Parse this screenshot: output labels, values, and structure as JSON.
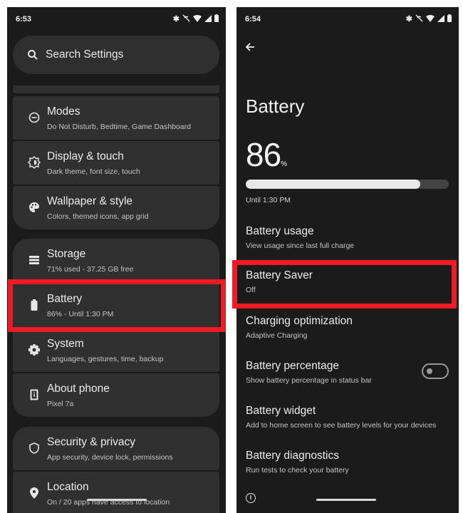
{
  "left": {
    "status": {
      "time": "6:53"
    },
    "search_placeholder": "Search Settings",
    "items": [
      {
        "title": "Modes",
        "subtitle": "Do Not Disturb, Bedtime, Game Dashboard",
        "icon": "minus-circle-icon"
      },
      {
        "title": "Display & touch",
        "subtitle": "Dark theme, font size, touch",
        "icon": "brightness-icon"
      },
      {
        "title": "Wallpaper & style",
        "subtitle": "Colors, themed icons, app grid",
        "icon": "palette-icon"
      },
      {
        "title": "Storage",
        "subtitle": "71% used - 37.25 GB free",
        "icon": "storage-icon"
      },
      {
        "title": "Battery",
        "subtitle": "86% - Until 1:30 PM",
        "icon": "battery-icon"
      },
      {
        "title": "System",
        "subtitle": "Languages, gestures, time, backup",
        "icon": "gear-icon"
      },
      {
        "title": "About phone",
        "subtitle": "Pixel 7a",
        "icon": "phone-info-icon"
      },
      {
        "title": "Security & privacy",
        "subtitle": "App security, device lock, permissions",
        "icon": "shield-icon"
      },
      {
        "title": "Location",
        "subtitle": "On / 20 apps have access to location",
        "icon": "location-pin-icon"
      }
    ]
  },
  "right": {
    "status": {
      "time": "6:54"
    },
    "title": "Battery",
    "percent": "86",
    "percent_unit": "%",
    "level": 0.86,
    "until": "Until 1:30 PM",
    "items": [
      {
        "title": "Battery usage",
        "subtitle": "View usage since last full charge"
      },
      {
        "title": "Battery Saver",
        "subtitle": "Off"
      },
      {
        "title": "Charging optimization",
        "subtitle": "Adaptive Charging"
      },
      {
        "title": "Battery percentage",
        "subtitle": "Show battery percentage in status bar",
        "toggle": false
      },
      {
        "title": "Battery widget",
        "subtitle": "Add to home screen to see battery levels for your devices"
      },
      {
        "title": "Battery diagnostics",
        "subtitle": "Run tests to check your battery"
      }
    ]
  },
  "colors": {
    "background": "#1b1b1b",
    "card": "#303030",
    "highlight": "#ee1b24"
  }
}
